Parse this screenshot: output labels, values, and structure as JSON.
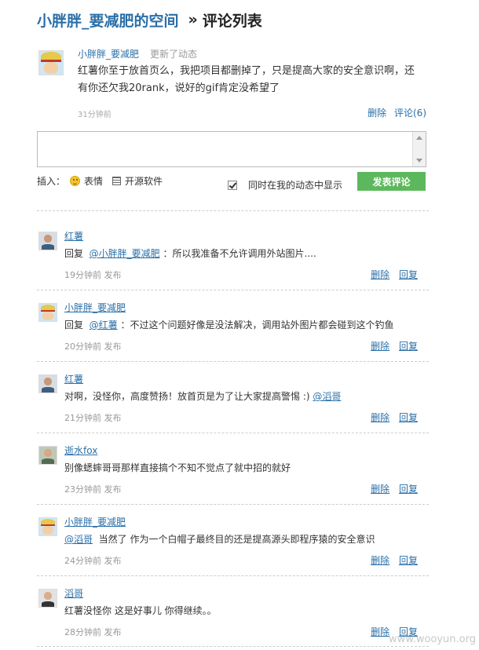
{
  "header": {
    "space_title": "小胖胖_要减肥的空间",
    "separator": "»",
    "page_title": "评论列表"
  },
  "post": {
    "author": "小胖胖_要减肥",
    "action": "更新了动态",
    "text": "红薯你至于放首页么，我把项目都删掉了，只是提高大家的安全意识啊，还有你还欠我20rank，说好的gif肯定没希望了",
    "time": "31分钟前",
    "delete_label": "删除",
    "comment_label": "评论(6)"
  },
  "editor": {
    "textarea_value": "",
    "insert_label": "插入：",
    "emoji_label": "表情",
    "software_label": "开源软件",
    "sync_label": "同时在我的动态中显示",
    "sync_checked": true,
    "submit_label": "发表评论"
  },
  "comments": [
    {
      "author": "红薯",
      "avatar": "man-icon",
      "prefix": "回复",
      "mention": "@小胖胖_要减肥",
      "text": "：所以我准备不允许调用外站图片....",
      "time": "19分钟前",
      "publish": "发布",
      "delete": "删除",
      "reply": "回复"
    },
    {
      "author": "小胖胖_要减肥",
      "avatar": "luffy-icon",
      "prefix": "回复",
      "mention": "@红薯",
      "text": "：不过这个问题好像是没法解决，调用站外图片都会碰到这个钓鱼",
      "time": "20分钟前",
      "publish": "发布",
      "delete": "删除",
      "reply": "回复"
    },
    {
      "author": "红薯",
      "avatar": "man-icon",
      "prefix": "",
      "mention": "",
      "text": "对啊，没怪你，高度赞扬！放首页是为了让大家提高警惕 :)",
      "mention_after": "@滔哥",
      "time": "21分钟前",
      "publish": "发布",
      "delete": "删除",
      "reply": "回复"
    },
    {
      "author": "逝水fox",
      "avatar": "man2-icon",
      "prefix": "",
      "mention": "",
      "text": "别像蟋蟀哥哥那样直接搞个不知不觉点了就中招的就好",
      "time": "23分钟前",
      "publish": "发布",
      "delete": "删除",
      "reply": "回复"
    },
    {
      "author": "小胖胖_要减肥",
      "avatar": "luffy-icon",
      "prefix": "",
      "mention": "@滔哥",
      "text": "当然了  作为一个白帽子最终目的还是提高源头即程序猿的安全意识",
      "time": "24分钟前",
      "publish": "发布",
      "delete": "删除",
      "reply": "回复"
    },
    {
      "author": "滔哥",
      "avatar": "man3-icon",
      "prefix": "",
      "mention": "",
      "text": "红薯没怪你  这是好事儿  你得继续。。",
      "time": "28分钟前",
      "publish": "发布",
      "delete": "删除",
      "reply": "回复"
    }
  ],
  "watermark": "www.wooyun.org"
}
